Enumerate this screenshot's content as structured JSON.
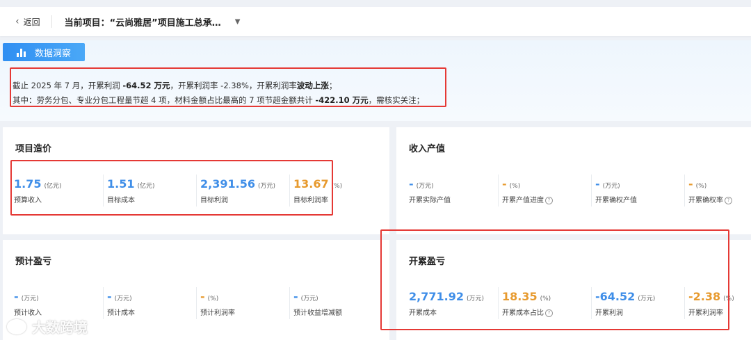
{
  "header": {
    "back_label": "返回",
    "project_title": "当前项目：“云尚雅居”项目施工总承…"
  },
  "insight": {
    "tag_label": "数据洞察",
    "line1_prefix": "截止 2025 年 7 月，开累利润 ",
    "line1_value1": "-64.52 万元",
    "line1_mid": "，开累利润率 -2.38%，开累利润率",
    "line1_trend": "波动上涨",
    "line1_suffix": "；",
    "line2_prefix": "其中：劳务分包、专业分包工程量节超 4 项，材料金额占比最高的 7 项节超金额共计 ",
    "line2_value": "-422.10 万元",
    "line2_suffix": "，需核实关注；"
  },
  "cards": {
    "project_cost": {
      "title": "项目造价",
      "metrics": [
        {
          "value": "1.75",
          "unit": "(亿元)",
          "label": "预算收入",
          "color": "blue"
        },
        {
          "value": "1.51",
          "unit": "(亿元)",
          "label": "目标成本",
          "color": "blue"
        },
        {
          "value": "2,391.56",
          "unit": "(万元)",
          "label": "目标利润",
          "color": "blue"
        },
        {
          "value": "13.67",
          "unit": "(%)",
          "label": "目标利润率",
          "color": "orange"
        }
      ]
    },
    "revenue": {
      "title": "收入产值",
      "metrics": [
        {
          "value": "-",
          "unit": "(万元)",
          "label": "开累实际产值",
          "color": "blue"
        },
        {
          "value": "-",
          "unit": "(%)",
          "label": "开累产值进度",
          "color": "orange",
          "help": "?"
        },
        {
          "value": "-",
          "unit": "(万元)",
          "label": "开累确权产值",
          "color": "blue"
        },
        {
          "value": "-",
          "unit": "(%)",
          "label": "开累确权率",
          "color": "orange",
          "help": "?"
        }
      ]
    },
    "forecast": {
      "title": "预计盈亏",
      "metrics": [
        {
          "value": "-",
          "unit": "(万元)",
          "label": "预计收入",
          "color": "blue"
        },
        {
          "value": "-",
          "unit": "(万元)",
          "label": "预计成本",
          "color": "blue"
        },
        {
          "value": "-",
          "unit": "(%)",
          "label": "预计利润率",
          "color": "orange"
        },
        {
          "value": "-",
          "unit": "(万元)",
          "label": "预计收益增减额",
          "color": "blue"
        }
      ]
    },
    "cumulative": {
      "title": "开累盈亏",
      "metrics": [
        {
          "value": "2,771.92",
          "unit": "(万元)",
          "label": "开累成本",
          "color": "blue"
        },
        {
          "value": "18.35",
          "unit": "(%)",
          "label": "开累成本占比",
          "color": "orange",
          "help": "?"
        },
        {
          "value": "-64.52",
          "unit": "(万元)",
          "label": "开累利润",
          "color": "blue"
        },
        {
          "value": "-2.38",
          "unit": "(%)",
          "label": "开累利润率",
          "color": "orange"
        }
      ]
    }
  },
  "watermark": "大数跨境"
}
